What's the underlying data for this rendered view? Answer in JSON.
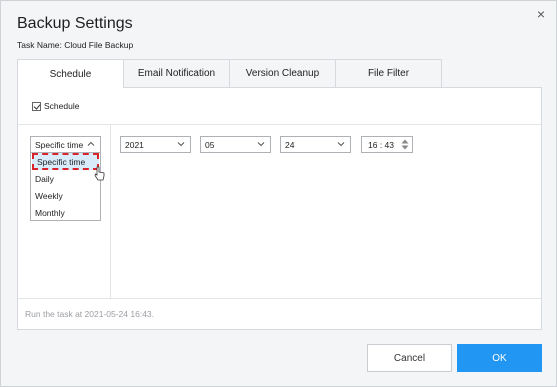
{
  "dialog": {
    "title": "Backup Settings",
    "task_name": "Task Name: Cloud File Backup",
    "close_glyph": "×"
  },
  "tabs": [
    {
      "label": "Schedule",
      "active": true
    },
    {
      "label": "Email Notification",
      "active": false
    },
    {
      "label": "Version Cleanup",
      "active": false
    },
    {
      "label": "File Filter",
      "active": false
    }
  ],
  "schedule": {
    "checkbox_label": "Schedule",
    "checked": true,
    "type_value": "Specific time",
    "type_options": [
      "Specific time",
      "Daily",
      "Weekly",
      "Monthly"
    ],
    "year": "2021",
    "month": "05",
    "day": "24",
    "time": "16 : 43",
    "summary": "Run the task at 2021-05-24 16:43."
  },
  "buttons": {
    "cancel": "Cancel",
    "ok": "OK"
  },
  "colors": {
    "accent": "#2196f3",
    "highlight_border": "#d8242a",
    "highlight_bg": "#d7ebfb"
  }
}
